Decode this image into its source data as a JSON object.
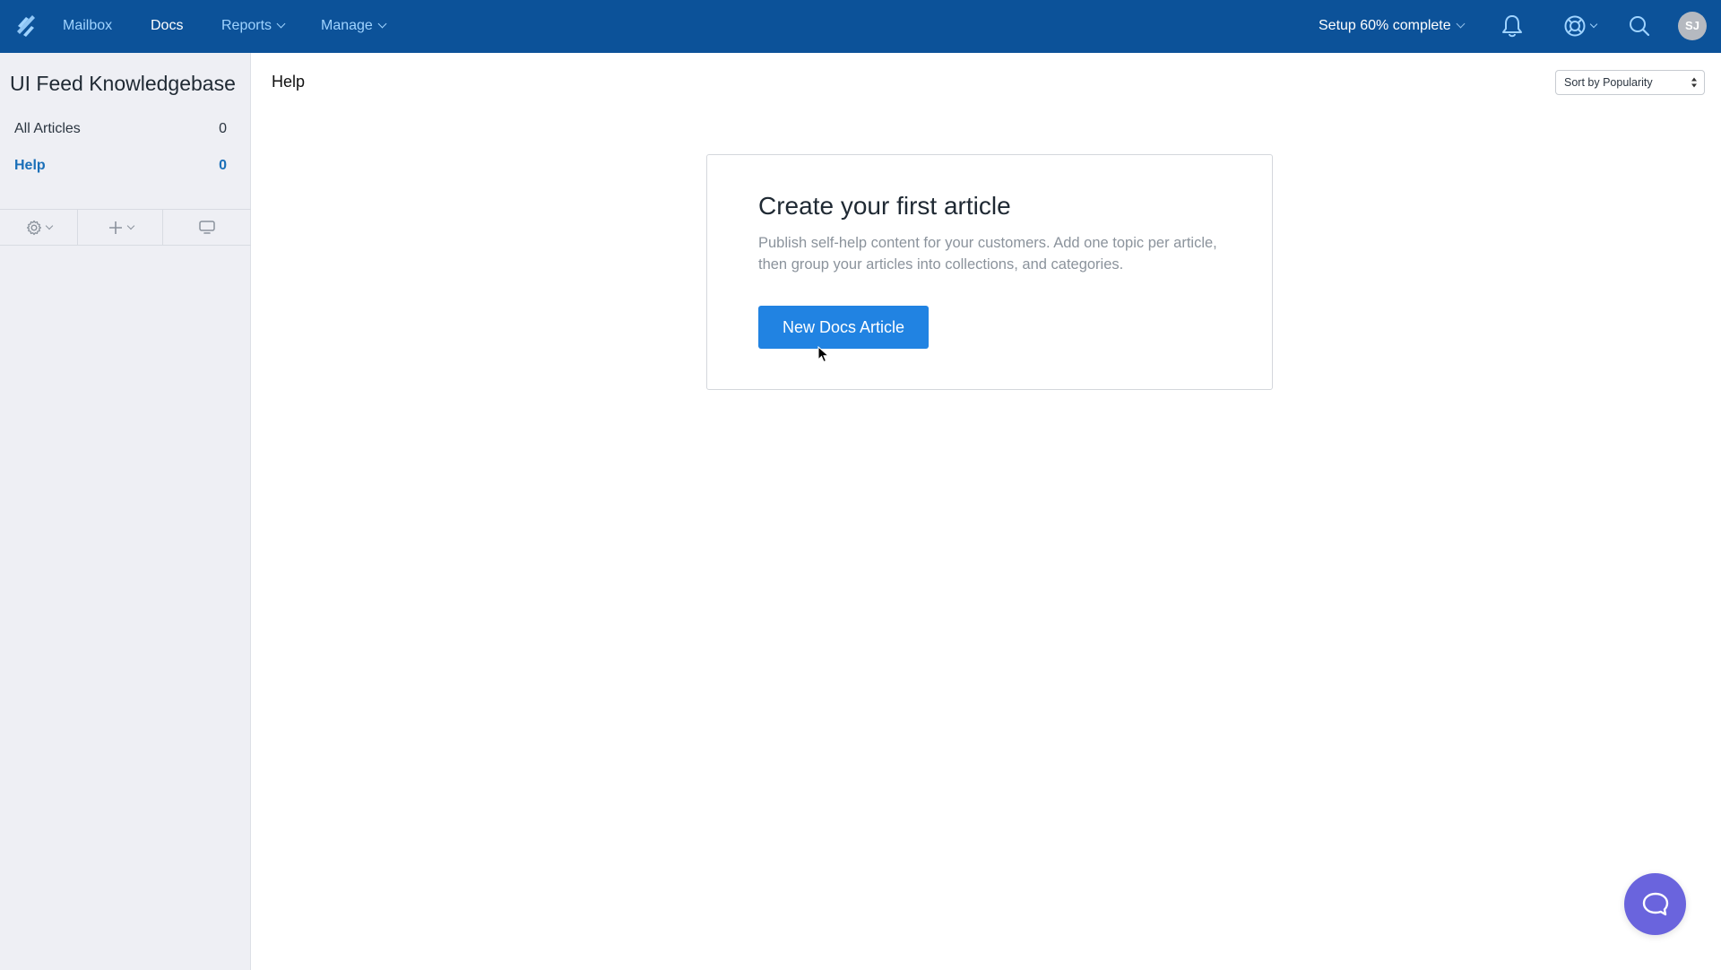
{
  "topbar": {
    "logo": "helpscout-logo",
    "nav": [
      {
        "label": "Mailbox",
        "active": false,
        "dropdown": false
      },
      {
        "label": "Docs",
        "active": true,
        "dropdown": false
      },
      {
        "label": "Reports",
        "active": false,
        "dropdown": true
      },
      {
        "label": "Manage",
        "active": false,
        "dropdown": true
      }
    ],
    "setup_label": "Setup 60% complete",
    "setup_progress_percent": 60,
    "icons": [
      "bell-icon",
      "lifebuoy-help-icon",
      "search-icon"
    ],
    "avatar_initials": "SJ",
    "bg_color": "#0c5299"
  },
  "sidebar": {
    "title": "UI Feed Knowledgebase",
    "items": [
      {
        "label": "All Articles",
        "count": "0",
        "active": false
      },
      {
        "label": "Help",
        "count": "0",
        "active": true
      }
    ],
    "toolbar": [
      "gear-icon",
      "plus-icon",
      "monitor-icon"
    ]
  },
  "main": {
    "title": "Help",
    "sort": {
      "selected": "Sort by Popularity"
    },
    "empty_state": {
      "title": "Create your first article",
      "description": "Publish self-help content for your customers. Add one topic per article, then group your articles into collections, and categories.",
      "button_label": "New Docs Article"
    }
  },
  "colors": {
    "primary": "#2183e2",
    "active_link": "#1a6fb8",
    "chat_bubble": "#6a64dd"
  }
}
